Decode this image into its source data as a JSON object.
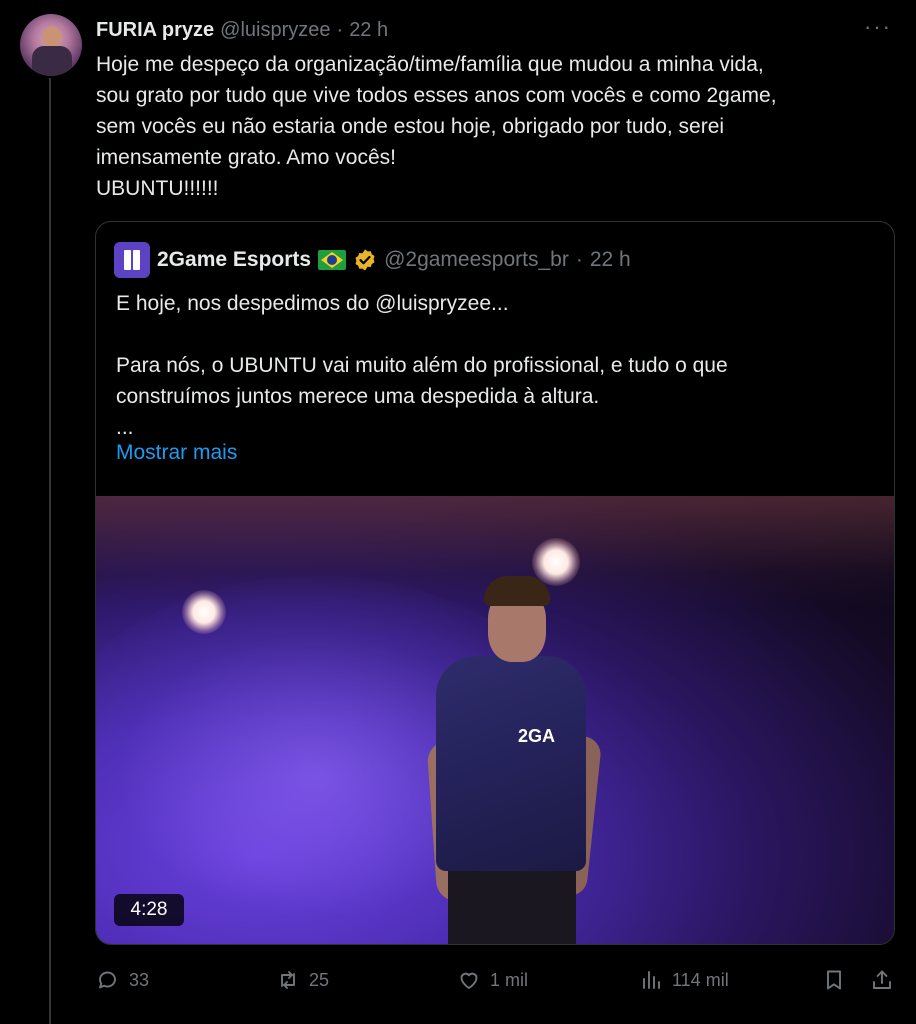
{
  "tweet": {
    "display_name": "FURIA pryze",
    "handle": "@luispryzee",
    "separator": "·",
    "time": "22 h",
    "text": "Hoje me despeço da organização/time/família que mudou a minha vida,\nsou grato por tudo que vive todos esses anos com vocês e como 2game,\nsem vocês eu não estaria onde estou hoje, obrigado por tudo, serei\nimensamente grato. Amo vocês!\nUBUNTU!!!!!!",
    "more_icon": "more-dots-icon"
  },
  "quote": {
    "display_name": "2Game Esports",
    "flag_icon": "brazil-flag-icon",
    "verified_icon": "verified-gold-badge-icon",
    "handle": "@2gameesports_br",
    "separator": "·",
    "time": "22 h",
    "text": "E hoje, nos despedimos do @luispryzee...\n\nPara nós, o UBUNTU vai muito além do profissional, e tudo o que\nconstruímos juntos merece uma despedida à altura.\n...",
    "show_more": "Mostrar mais",
    "video_duration": "4:28",
    "video_jersey_text": "2GA"
  },
  "actions": {
    "reply_count": "33",
    "retweet_count": "25",
    "like_count": "1 mil",
    "views_count": "114 mil"
  },
  "colors": {
    "background": "#000000",
    "text": "#e7e9ea",
    "muted": "#71767b",
    "link": "#1d9bf0",
    "border": "#2f3336"
  }
}
